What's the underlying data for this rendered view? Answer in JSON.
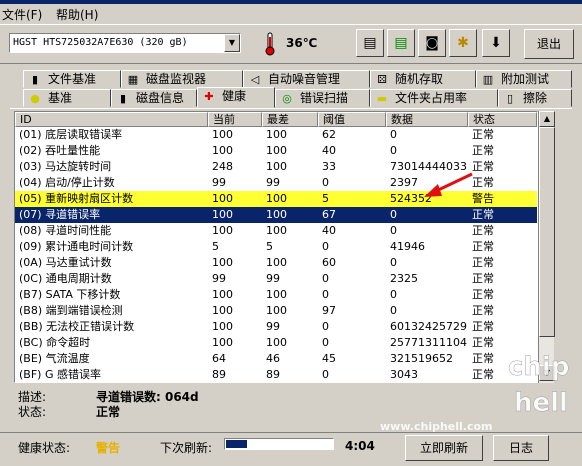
{
  "menu": {
    "file": "文件(F)",
    "help": "帮助(H)"
  },
  "toolbar": {
    "drive": "HGST HTS725032A7E630 (320 gB)",
    "temperature": "36℃",
    "exit_label": "退出",
    "icons": [
      "thermometer-icon",
      "copy-icon",
      "copy-all-icon",
      "camera-icon",
      "tools-icon",
      "download-icon"
    ]
  },
  "tabs_row1": [
    {
      "label": "文件基准",
      "icon": "file-icon"
    },
    {
      "label": "磁盘监视器",
      "icon": "monitor-icon"
    },
    {
      "label": "自动噪音管理",
      "icon": "speaker-icon"
    },
    {
      "label": "随机存取",
      "icon": "dice-icon"
    },
    {
      "label": "附加测试",
      "icon": "chart-icon"
    }
  ],
  "tabs_row2": [
    {
      "label": "基准",
      "icon": "bulb-icon"
    },
    {
      "label": "磁盘信息",
      "icon": "disk-icon"
    },
    {
      "label": "健康",
      "icon": "cross-icon"
    },
    {
      "label": "错误扫描",
      "icon": "magnifier-icon"
    },
    {
      "label": "文件夹占用率",
      "icon": "folder-icon"
    },
    {
      "label": "擦除",
      "icon": "trash-icon"
    }
  ],
  "columns": [
    "ID",
    "当前",
    "最差",
    "阈值",
    "数据",
    "状态"
  ],
  "rows": [
    {
      "id": "(01) 底层读取错误率",
      "cur": "100",
      "worst": "100",
      "th": "62",
      "data": "0",
      "status": "正常"
    },
    {
      "id": "(02) 吞吐量性能",
      "cur": "100",
      "worst": "100",
      "th": "40",
      "data": "0",
      "status": "正常"
    },
    {
      "id": "(03) 马达旋转时间",
      "cur": "248",
      "worst": "100",
      "th": "33",
      "data": "73014444033",
      "status": "正常"
    },
    {
      "id": "(04) 启动/停止计数",
      "cur": "99",
      "worst": "99",
      "th": "0",
      "data": "2397",
      "status": "正常"
    },
    {
      "id": "(05) 重新映射扇区计数",
      "cur": "100",
      "worst": "100",
      "th": "5",
      "data": "524352",
      "status": "警告"
    },
    {
      "id": "(07) 寻道错误率",
      "cur": "100",
      "worst": "100",
      "th": "67",
      "data": "0",
      "status": "正常"
    },
    {
      "id": "(08) 寻道时间性能",
      "cur": "100",
      "worst": "100",
      "th": "40",
      "data": "0",
      "status": "正常"
    },
    {
      "id": "(09) 累计通电时间计数",
      "cur": "5",
      "worst": "5",
      "th": "0",
      "data": "41946",
      "status": "正常"
    },
    {
      "id": "(0A) 马达重试计数",
      "cur": "100",
      "worst": "100",
      "th": "60",
      "data": "0",
      "status": "正常"
    },
    {
      "id": "(0C) 通电周期计数",
      "cur": "99",
      "worst": "99",
      "th": "0",
      "data": "2325",
      "status": "正常"
    },
    {
      "id": "(B7) SATA 下移计数",
      "cur": "100",
      "worst": "100",
      "th": "0",
      "data": "0",
      "status": "正常"
    },
    {
      "id": "(B8) 端到端错误检测",
      "cur": "100",
      "worst": "100",
      "th": "97",
      "data": "0",
      "status": "正常"
    },
    {
      "id": "(BB) 无法校正错误计数",
      "cur": "100",
      "worst": "99",
      "th": "0",
      "data": "60132425729",
      "status": "正常"
    },
    {
      "id": "(BC) 命令超时",
      "cur": "100",
      "worst": "100",
      "th": "0",
      "data": "25771311104",
      "status": "正常"
    },
    {
      "id": "(BE) 气流温度",
      "cur": "64",
      "worst": "46",
      "th": "45",
      "data": "321519652",
      "status": "正常"
    },
    {
      "id": "(BF) G 感错误率",
      "cur": "89",
      "worst": "89",
      "th": "0",
      "data": "3043",
      "status": "正常"
    }
  ],
  "detail": {
    "desc_label": "描述:",
    "desc_value": "寻道错误数: 064d",
    "status_label": "状态:",
    "status_value": "正常"
  },
  "statusbar": {
    "health_label": "健康状态:",
    "health_value": "警告",
    "next_refresh_label": "下次刷新:",
    "countdown": "4:04",
    "refresh_label": "立即刷新",
    "log_label": "日志",
    "progress": 0.2
  },
  "watermark": "www.chiphell.com",
  "logo_text": "chip hell"
}
